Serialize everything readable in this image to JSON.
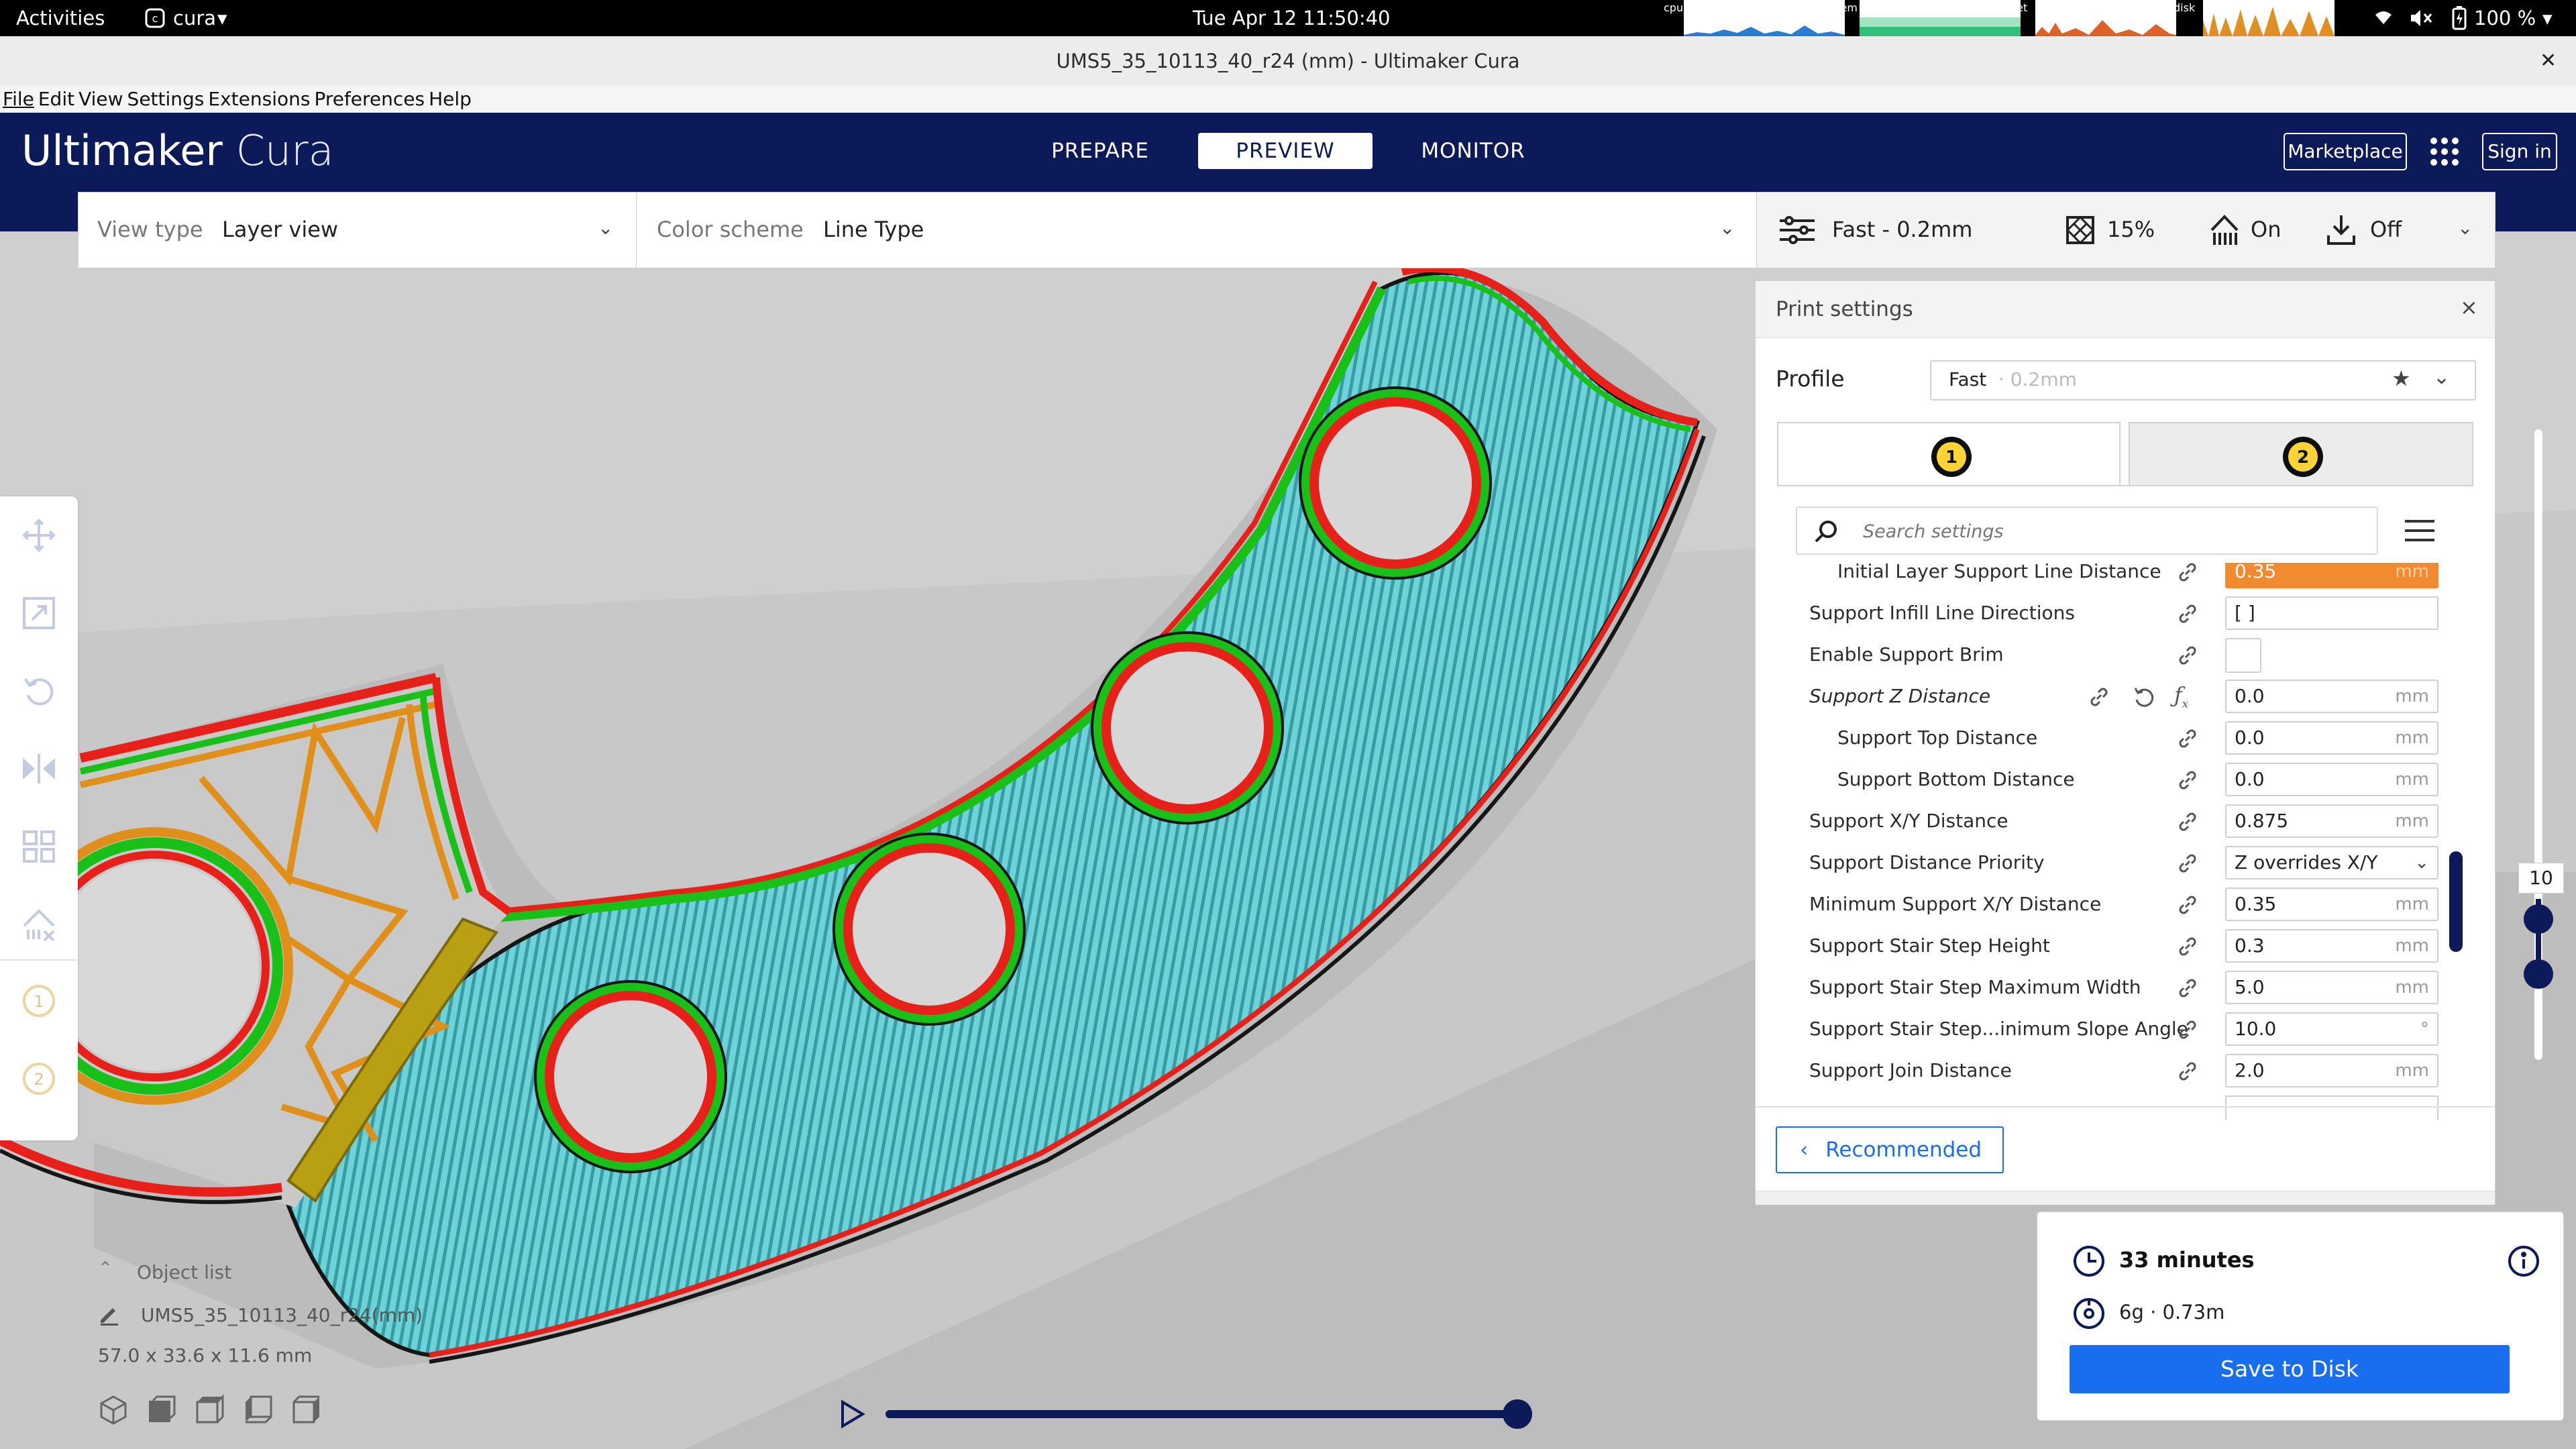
{
  "system_bar": {
    "activities": "Activities",
    "app_name": "cura",
    "clock": "Tue Apr 12  11:50:40",
    "monitors": [
      "cpu",
      "mem",
      "net",
      "disk"
    ],
    "battery": "100 %"
  },
  "window": {
    "title": "UMS5_35_10113_40_r24 (mm) - Ultimaker Cura",
    "close": "✕"
  },
  "menu": [
    "File",
    "Edit",
    "View",
    "Settings",
    "Extensions",
    "Preferences",
    "Help"
  ],
  "header": {
    "brand_bold": "Ultimaker",
    "brand_light": "Cura",
    "tabs": [
      "PREPARE",
      "PREVIEW",
      "MONITOR"
    ],
    "active_tab": "PREVIEW",
    "marketplace": "Marketplace",
    "sign_in": "Sign in"
  },
  "toolbar": {
    "view_type_label": "View type",
    "view_type_value": "Layer view",
    "color_scheme_label": "Color scheme",
    "color_scheme_value": "Line Type",
    "profile_summary": "Fast - 0.2mm",
    "infill": "15%",
    "support": "On",
    "adhesion": "Off"
  },
  "print_settings": {
    "title": "Print settings",
    "profile_label": "Profile",
    "profile_name": "Fast",
    "profile_layer": " · 0.2mm",
    "extruders": [
      "1",
      "2"
    ],
    "search_placeholder": "Search settings",
    "rows": [
      {
        "name": "Initial Layer Support Line Distance",
        "value": "0.35",
        "unit": "mm",
        "indent": 1,
        "highlight": true
      },
      {
        "name": "Support Infill Line Directions",
        "value": "[ ]",
        "unit": "",
        "indent": 0
      },
      {
        "name": "Enable Support Brim",
        "value": "",
        "unit": "",
        "indent": 0,
        "checkbox": true
      },
      {
        "name": "Support Z Distance",
        "value": "0.0",
        "unit": "mm",
        "indent": 0,
        "italic": true
      },
      {
        "name": "Support Top Distance",
        "value": "0.0",
        "unit": "mm",
        "indent": 1
      },
      {
        "name": "Support Bottom Distance",
        "value": "0.0",
        "unit": "mm",
        "indent": 1
      },
      {
        "name": "Support X/Y Distance",
        "value": "0.875",
        "unit": "mm",
        "indent": 0
      },
      {
        "name": "Support Distance Priority",
        "value": "Z overrides X/Y",
        "unit": "",
        "indent": 0,
        "dropdown": true
      },
      {
        "name": "Minimum Support X/Y Distance",
        "value": "0.35",
        "unit": "mm",
        "indent": 0
      },
      {
        "name": "Support Stair Step Height",
        "value": "0.3",
        "unit": "mm",
        "indent": 0
      },
      {
        "name": "Support Stair Step Maximum Width",
        "value": "5.0",
        "unit": "mm",
        "indent": 0
      },
      {
        "name": "Support Stair Step...inimum Slope Angle",
        "value": "10.0",
        "unit": "°",
        "indent": 0
      },
      {
        "name": "Support Join Distance",
        "value": "2.0",
        "unit": "mm",
        "indent": 0
      }
    ],
    "recommended": "Recommended"
  },
  "job": {
    "time": "33 minutes",
    "material": "6g · 0.73m",
    "save": "Save to Disk"
  },
  "object_list": {
    "title": "Object list",
    "object_name": "UMS5_35_10113_40_r24(mm)",
    "dimensions": "57.0 x 33.6 x 11.6 mm"
  },
  "layer_slider": {
    "current_layer": "10"
  },
  "colors": {
    "header": "#0c1a5a",
    "accent": "#196ef0",
    "support": "#6ed3d8",
    "wall_outer": "#e8201a",
    "wall_inner": "#18c018",
    "infill": "#e0901a",
    "highlight_field": "#f28a30"
  }
}
